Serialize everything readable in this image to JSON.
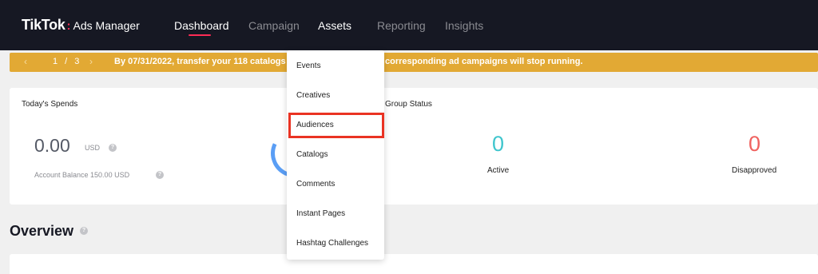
{
  "nav": {
    "brand": "TikTok",
    "colon": ":",
    "product": "Ads Manager",
    "items": [
      {
        "label": "Dashboard"
      },
      {
        "label": "Campaign"
      },
      {
        "label": "Assets"
      },
      {
        "label": "Reporting"
      },
      {
        "label": "Insights"
      }
    ]
  },
  "banner": {
    "prev_icon": "chevron-left-icon",
    "next_icon": "chevron-right-icon",
    "page": "1 / 3",
    "text_left": "By 07/31/2022, transfer your 118 catalogs to a",
    "text_right": "corresponding ad campaigns will stop running."
  },
  "spends": {
    "title": "Today's Spends",
    "value": "0.00",
    "unit": "USD",
    "balance": "Account Balance 150.00 USD"
  },
  "status": {
    "title": "Group Status",
    "active_value": "0",
    "active_label": "Active",
    "disapproved_value": "0",
    "disapproved_label": "Disapproved",
    "active_color": "#3fc5cd",
    "disapproved_color": "#f0625f"
  },
  "overview": {
    "title": "Overview"
  },
  "assets_menu": {
    "items": [
      {
        "label": "Events"
      },
      {
        "label": "Creatives"
      },
      {
        "label": "Audiences"
      },
      {
        "label": "Catalogs"
      },
      {
        "label": "Comments"
      },
      {
        "label": "Instant Pages"
      },
      {
        "label": "Hashtag Challenges"
      }
    ],
    "highlighted": "Audiences"
  },
  "colors": {
    "nav_bg": "#161823",
    "accent": "#fe2c55",
    "banner": "#e2a934",
    "highlight": "#ea3323"
  }
}
